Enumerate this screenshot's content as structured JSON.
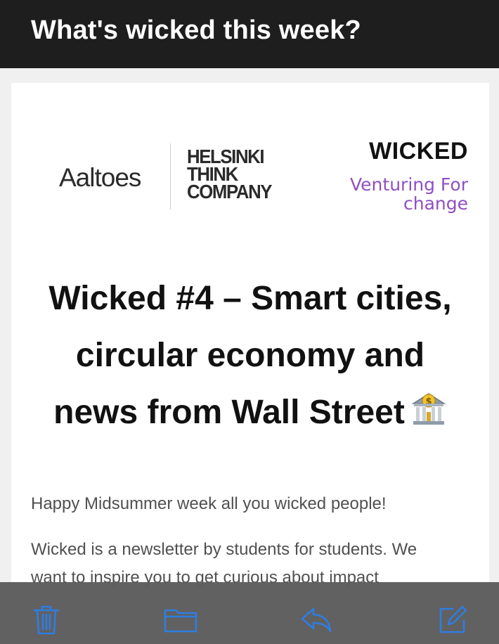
{
  "header": {
    "title": "What's wicked this week?"
  },
  "logos": {
    "aaltoes": "Aaltoes",
    "helsinki_think_company": [
      "HELSINKI",
      "THINK",
      "COMPANY"
    ],
    "wicked": {
      "name": "WICKED",
      "tagline": "Venturing For change"
    }
  },
  "headline": {
    "line1": "Wicked #4 – Smart cities,",
    "line2": "circular economy and",
    "line3": "news from Wall Street",
    "emoji": "bank-icon"
  },
  "body": {
    "greeting": "Happy Midsummer week all you wicked people!",
    "intro_line1": "Wicked is a newsletter by students for students. We",
    "intro_line2": "want to inspire you to get curious about impact"
  },
  "toolbar": {
    "accent_color": "#2f7de1",
    "buttons": [
      "trash-icon",
      "folder-icon",
      "reply-icon",
      "compose-icon"
    ]
  }
}
